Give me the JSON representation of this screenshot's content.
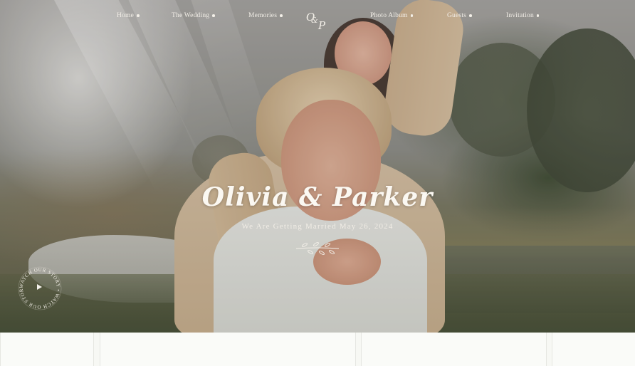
{
  "nav": {
    "left": [
      "Home",
      "The Wedding",
      "Memories"
    ],
    "right": [
      "Photo Album",
      "Guests",
      "Invitation"
    ]
  },
  "logo": {
    "first": "O",
    "second": "P"
  },
  "hero": {
    "title": "Olivia & Parker",
    "subtitle": "We Are Getting Married May 26, 2024"
  },
  "story_badge": {
    "text": "WATCH OUR STORY • WATCH OUR STORY •"
  },
  "colors": {
    "text_light": "#f3efe8",
    "page_bg": "#f6f7f3"
  },
  "icons": [
    "play-icon",
    "olive-branch-icon"
  ]
}
